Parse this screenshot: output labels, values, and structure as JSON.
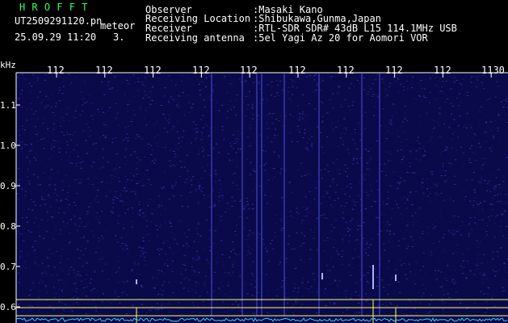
{
  "header": {
    "logo_text": "HROFFT",
    "filename": "UT2509291120.pn",
    "tag": "meteor",
    "datetime": "25.09.29 11:20",
    "count": "3.",
    "info": [
      {
        "label": "Observer",
        "value": ":Masaki Kano"
      },
      {
        "label": "Receiving Location",
        "value": ":Shibukawa,Gunma,Japan"
      },
      {
        "label": "Receiver",
        "value": ":RTL-SDR SDR# 43dB L15 114.1MHz USB"
      },
      {
        "label": "Receiving antenna",
        "value": ":5el Yagi Az 20 for Aomori VOR"
      }
    ]
  },
  "spectrogram": {
    "y_unit": "kHz",
    "y_ticks": [
      "1.1",
      "1.0",
      "0.9",
      "0.8",
      "0.7",
      "0.6"
    ],
    "x_ticks": [
      "112",
      "112",
      "112",
      "112",
      "112",
      "112",
      "112",
      "112",
      "112",
      "1130"
    ],
    "colors": {
      "background": "#0a0a4a",
      "noise": "#2a2a8a",
      "axis": "#ffffff",
      "marker_line": "#ffff66",
      "bottom_trace": "#33ccff",
      "logo": "#33ff66"
    }
  }
}
